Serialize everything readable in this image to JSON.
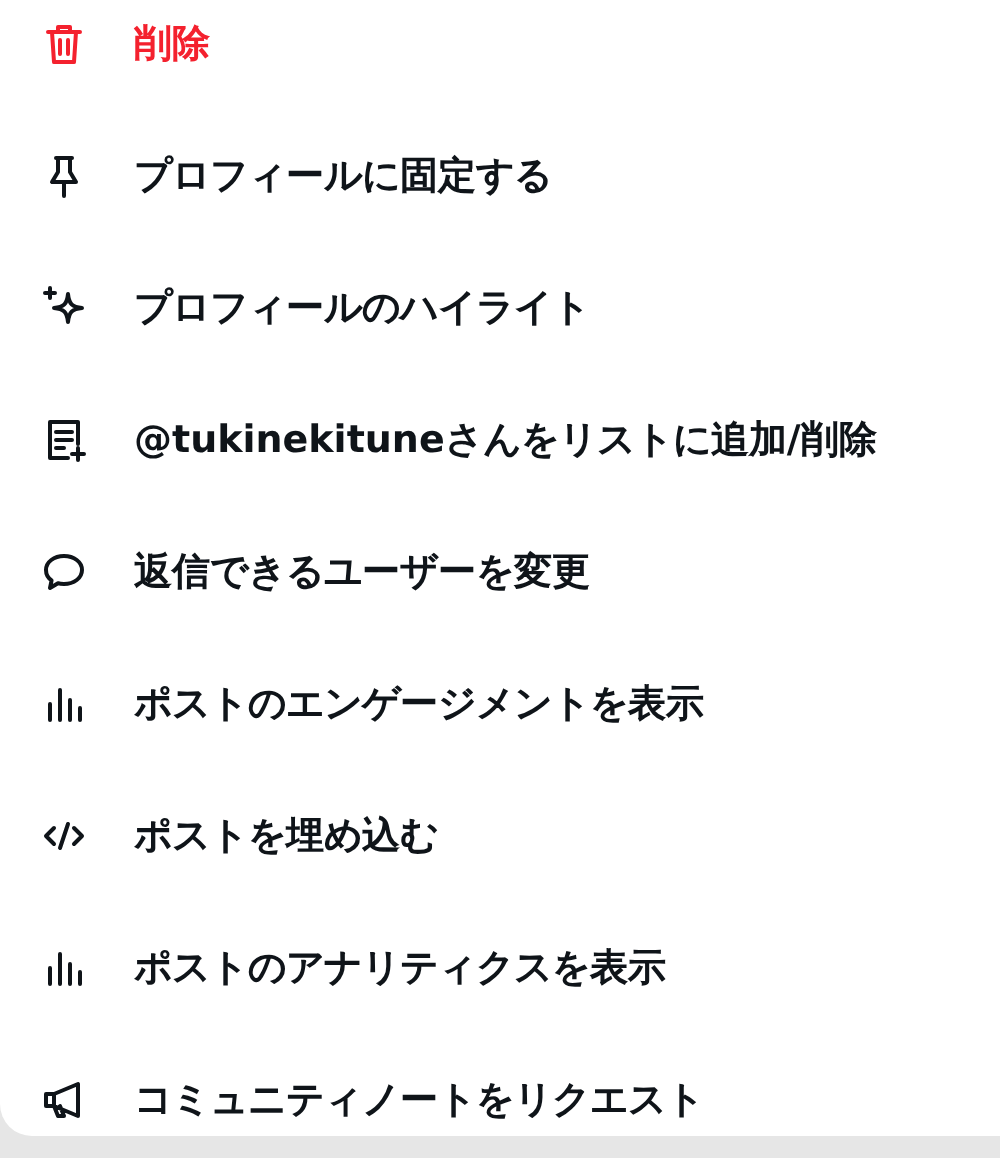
{
  "menu": {
    "items": [
      {
        "label": "削除",
        "kind": "danger"
      },
      {
        "label": "プロフィールに固定する",
        "kind": "normal"
      },
      {
        "label": "プロフィールのハイライト",
        "kind": "normal"
      },
      {
        "label": "@tukinekituneさんをリストに追加/削除",
        "kind": "normal"
      },
      {
        "label": "返信できるユーザーを変更",
        "kind": "normal"
      },
      {
        "label": "ポストのエンゲージメントを表示",
        "kind": "normal"
      },
      {
        "label": "ポストを埋め込む",
        "kind": "normal"
      },
      {
        "label": "ポストのアナリティクスを表示",
        "kind": "normal"
      },
      {
        "label": "コミュニティノートをリクエスト",
        "kind": "normal"
      }
    ]
  }
}
